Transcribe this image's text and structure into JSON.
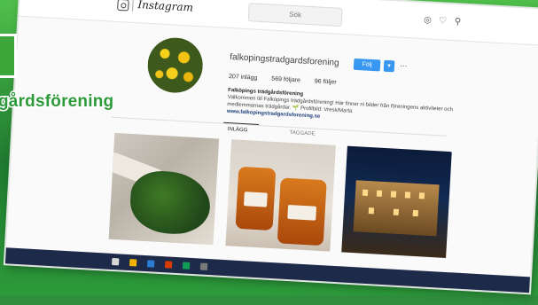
{
  "browser": {
    "app_name": "Instagram",
    "search_placeholder": "Sök"
  },
  "profile": {
    "username": "falkopingstradgardsforening",
    "follow_label": "Följ",
    "dropdown_label": "▾",
    "more_label": "...",
    "stats": {
      "posts": "207 inlägg",
      "followers": "569 följare",
      "following": "96 följer"
    },
    "bio": {
      "name": "Falköpings trädgårdsförening",
      "text": "Välkommen till Falköpings trädgårdsförening! Här finner ni bilder från föreningens aktiviteter och medlemmarnas trädgårdar. 🌱 Profilbild: Vresk/Marta",
      "link": "www.falkopingstradgardsforening.se"
    },
    "tabs": [
      "INLÄGG",
      "TAGGADE"
    ]
  },
  "overlay": {
    "banner_text": "gårdsförening"
  },
  "colors": {
    "accent": "#3897f0",
    "banner_green": "#2d9a3a",
    "background_green": "#2f8f3e"
  }
}
